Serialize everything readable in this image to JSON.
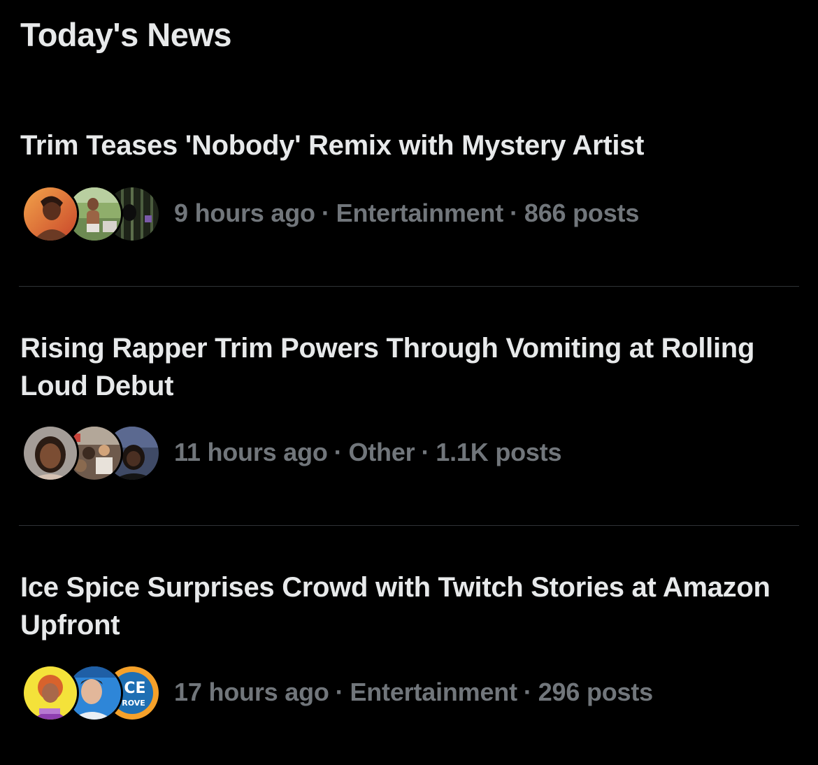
{
  "section_title": "Today's News",
  "colors": {
    "background": "#000000",
    "headline": "#e7e9ea",
    "meta": "#71767b",
    "divider": "#2f3336"
  },
  "stories": [
    {
      "headline": "Trim Teases 'Nobody' Remix with Mystery Artist",
      "time": "9 hours ago",
      "category": "Entertainment",
      "posts": "866 posts",
      "avatars": [
        "avatar-photo-orange",
        "avatar-photo-outdoor",
        "avatar-photo-dark"
      ]
    },
    {
      "headline": "Rising Rapper Trim Powers Through Vomiting at Rolling Loud Debut",
      "time": "11 hours ago",
      "category": "Other",
      "posts": "1.1K posts",
      "avatars": [
        "avatar-photo-portrait",
        "avatar-photo-crowd",
        "avatar-photo-stage"
      ]
    },
    {
      "headline": "Ice Spice Surprises Crowd with Twitch Stories at Amazon Upfront",
      "time": "17 hours ago",
      "category": "Entertainment",
      "posts": "296 posts",
      "avatars": [
        "avatar-cartoon-yellow",
        "avatar-photo-blue",
        "avatar-logo-ice-grove"
      ],
      "logo_text": [
        "CE",
        "ROVE"
      ]
    }
  ],
  "separator": "·"
}
